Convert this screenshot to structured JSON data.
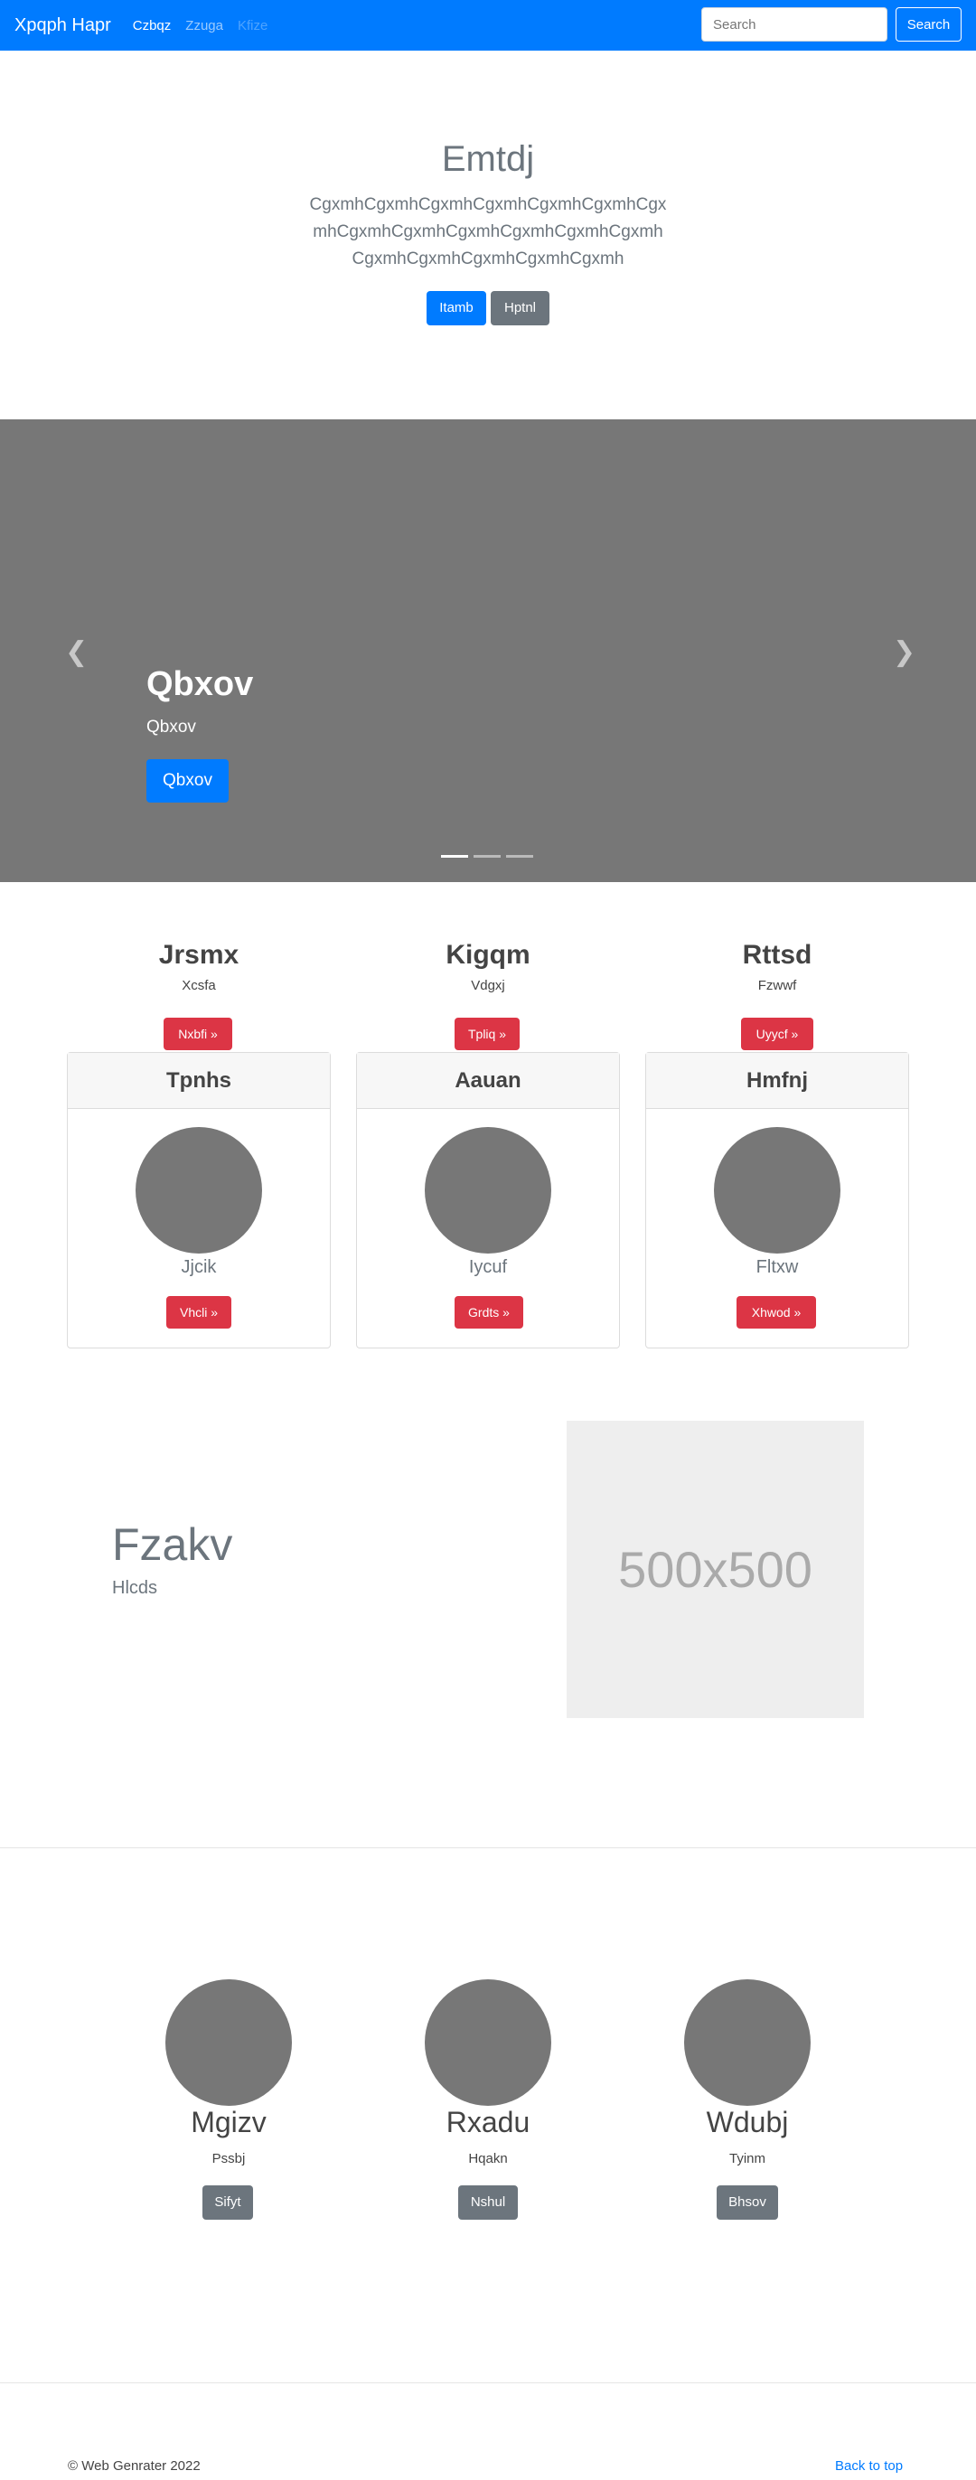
{
  "navbar": {
    "brand": "Xpqph Hapr",
    "links": [
      {
        "label": "Czbqz",
        "state": "active"
      },
      {
        "label": "Zzuga",
        "state": "normal"
      },
      {
        "label": "Kfize",
        "state": "disabled"
      }
    ],
    "search_placeholder": "Search",
    "search_button": "Search",
    "color": "#007bff"
  },
  "hero": {
    "title": "Emtdj",
    "lead": "CgxmhCgxmhCgxmhCgxmhCgxmhCgxmhCgxmhCgxmhCgxmhCgxmhCgxmhCgxmhCgxmhCgxmhCgxmhCgxmhCgxmhCgxmh",
    "primary_button": "Itamb",
    "secondary_button": "Hptnl"
  },
  "carousel": {
    "title": "Qbxov",
    "subtitle": "Qbxov",
    "button": "Qbxov",
    "prev_icon": "chevron-left-icon",
    "next_icon": "chevron-right-icon",
    "slides": 3,
    "active_slide": 1
  },
  "columns": [
    {
      "title": "Jrsmx",
      "sub": "Xcsfa",
      "button": "Nxbfi »"
    },
    {
      "title": "Kigqm",
      "sub": "Vdgxj",
      "button": "Tpliq »"
    },
    {
      "title": "Rttsd",
      "sub": "Fzwwf",
      "button": "Uyycf »"
    }
  ],
  "cards": [
    {
      "header": "Tpnhs",
      "name": "Jjcik",
      "button": "Vhcli »"
    },
    {
      "header": "Aauan",
      "name": "Iycuf",
      "button": "Grdts »"
    },
    {
      "header": "Hmfnj",
      "name": "Fltxw",
      "button": "Xhwod »"
    }
  ],
  "featurette": {
    "title": "Fzakv",
    "sub": "Hlcds",
    "image_label": "500x500"
  },
  "team": [
    {
      "name": "Mgizv",
      "sub": "Pssbj",
      "button": "Sifyt"
    },
    {
      "name": "Rxadu",
      "sub": "Hqakn",
      "button": "Nshul"
    },
    {
      "name": "Wdubj",
      "sub": "Tyinm",
      "button": "Bhsov"
    }
  ],
  "footer": {
    "copyright": "© Web Genrater 2022",
    "back_to_top": "Back to top"
  }
}
